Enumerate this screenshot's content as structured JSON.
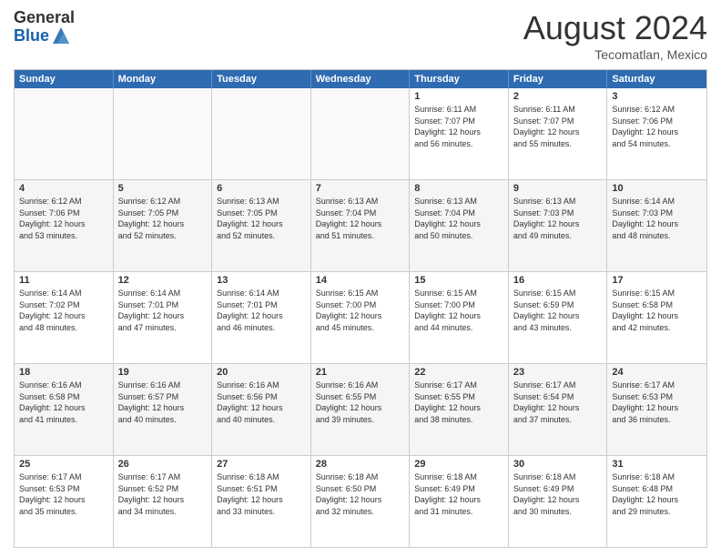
{
  "logo": {
    "general": "General",
    "blue": "Blue"
  },
  "title": "August 2024",
  "subtitle": "Tecomatlan, Mexico",
  "days": [
    "Sunday",
    "Monday",
    "Tuesday",
    "Wednesday",
    "Thursday",
    "Friday",
    "Saturday"
  ],
  "weeks": [
    [
      {
        "day": "",
        "info": ""
      },
      {
        "day": "",
        "info": ""
      },
      {
        "day": "",
        "info": ""
      },
      {
        "day": "",
        "info": ""
      },
      {
        "day": "1",
        "info": "Sunrise: 6:11 AM\nSunset: 7:07 PM\nDaylight: 12 hours\nand 56 minutes."
      },
      {
        "day": "2",
        "info": "Sunrise: 6:11 AM\nSunset: 7:07 PM\nDaylight: 12 hours\nand 55 minutes."
      },
      {
        "day": "3",
        "info": "Sunrise: 6:12 AM\nSunset: 7:06 PM\nDaylight: 12 hours\nand 54 minutes."
      }
    ],
    [
      {
        "day": "4",
        "info": "Sunrise: 6:12 AM\nSunset: 7:06 PM\nDaylight: 12 hours\nand 53 minutes."
      },
      {
        "day": "5",
        "info": "Sunrise: 6:12 AM\nSunset: 7:05 PM\nDaylight: 12 hours\nand 52 minutes."
      },
      {
        "day": "6",
        "info": "Sunrise: 6:13 AM\nSunset: 7:05 PM\nDaylight: 12 hours\nand 52 minutes."
      },
      {
        "day": "7",
        "info": "Sunrise: 6:13 AM\nSunset: 7:04 PM\nDaylight: 12 hours\nand 51 minutes."
      },
      {
        "day": "8",
        "info": "Sunrise: 6:13 AM\nSunset: 7:04 PM\nDaylight: 12 hours\nand 50 minutes."
      },
      {
        "day": "9",
        "info": "Sunrise: 6:13 AM\nSunset: 7:03 PM\nDaylight: 12 hours\nand 49 minutes."
      },
      {
        "day": "10",
        "info": "Sunrise: 6:14 AM\nSunset: 7:03 PM\nDaylight: 12 hours\nand 48 minutes."
      }
    ],
    [
      {
        "day": "11",
        "info": "Sunrise: 6:14 AM\nSunset: 7:02 PM\nDaylight: 12 hours\nand 48 minutes."
      },
      {
        "day": "12",
        "info": "Sunrise: 6:14 AM\nSunset: 7:01 PM\nDaylight: 12 hours\nand 47 minutes."
      },
      {
        "day": "13",
        "info": "Sunrise: 6:14 AM\nSunset: 7:01 PM\nDaylight: 12 hours\nand 46 minutes."
      },
      {
        "day": "14",
        "info": "Sunrise: 6:15 AM\nSunset: 7:00 PM\nDaylight: 12 hours\nand 45 minutes."
      },
      {
        "day": "15",
        "info": "Sunrise: 6:15 AM\nSunset: 7:00 PM\nDaylight: 12 hours\nand 44 minutes."
      },
      {
        "day": "16",
        "info": "Sunrise: 6:15 AM\nSunset: 6:59 PM\nDaylight: 12 hours\nand 43 minutes."
      },
      {
        "day": "17",
        "info": "Sunrise: 6:15 AM\nSunset: 6:58 PM\nDaylight: 12 hours\nand 42 minutes."
      }
    ],
    [
      {
        "day": "18",
        "info": "Sunrise: 6:16 AM\nSunset: 6:58 PM\nDaylight: 12 hours\nand 41 minutes."
      },
      {
        "day": "19",
        "info": "Sunrise: 6:16 AM\nSunset: 6:57 PM\nDaylight: 12 hours\nand 40 minutes."
      },
      {
        "day": "20",
        "info": "Sunrise: 6:16 AM\nSunset: 6:56 PM\nDaylight: 12 hours\nand 40 minutes."
      },
      {
        "day": "21",
        "info": "Sunrise: 6:16 AM\nSunset: 6:55 PM\nDaylight: 12 hours\nand 39 minutes."
      },
      {
        "day": "22",
        "info": "Sunrise: 6:17 AM\nSunset: 6:55 PM\nDaylight: 12 hours\nand 38 minutes."
      },
      {
        "day": "23",
        "info": "Sunrise: 6:17 AM\nSunset: 6:54 PM\nDaylight: 12 hours\nand 37 minutes."
      },
      {
        "day": "24",
        "info": "Sunrise: 6:17 AM\nSunset: 6:53 PM\nDaylight: 12 hours\nand 36 minutes."
      }
    ],
    [
      {
        "day": "25",
        "info": "Sunrise: 6:17 AM\nSunset: 6:53 PM\nDaylight: 12 hours\nand 35 minutes."
      },
      {
        "day": "26",
        "info": "Sunrise: 6:17 AM\nSunset: 6:52 PM\nDaylight: 12 hours\nand 34 minutes."
      },
      {
        "day": "27",
        "info": "Sunrise: 6:18 AM\nSunset: 6:51 PM\nDaylight: 12 hours\nand 33 minutes."
      },
      {
        "day": "28",
        "info": "Sunrise: 6:18 AM\nSunset: 6:50 PM\nDaylight: 12 hours\nand 32 minutes."
      },
      {
        "day": "29",
        "info": "Sunrise: 6:18 AM\nSunset: 6:49 PM\nDaylight: 12 hours\nand 31 minutes."
      },
      {
        "day": "30",
        "info": "Sunrise: 6:18 AM\nSunset: 6:49 PM\nDaylight: 12 hours\nand 30 minutes."
      },
      {
        "day": "31",
        "info": "Sunrise: 6:18 AM\nSunset: 6:48 PM\nDaylight: 12 hours\nand 29 minutes."
      }
    ]
  ]
}
